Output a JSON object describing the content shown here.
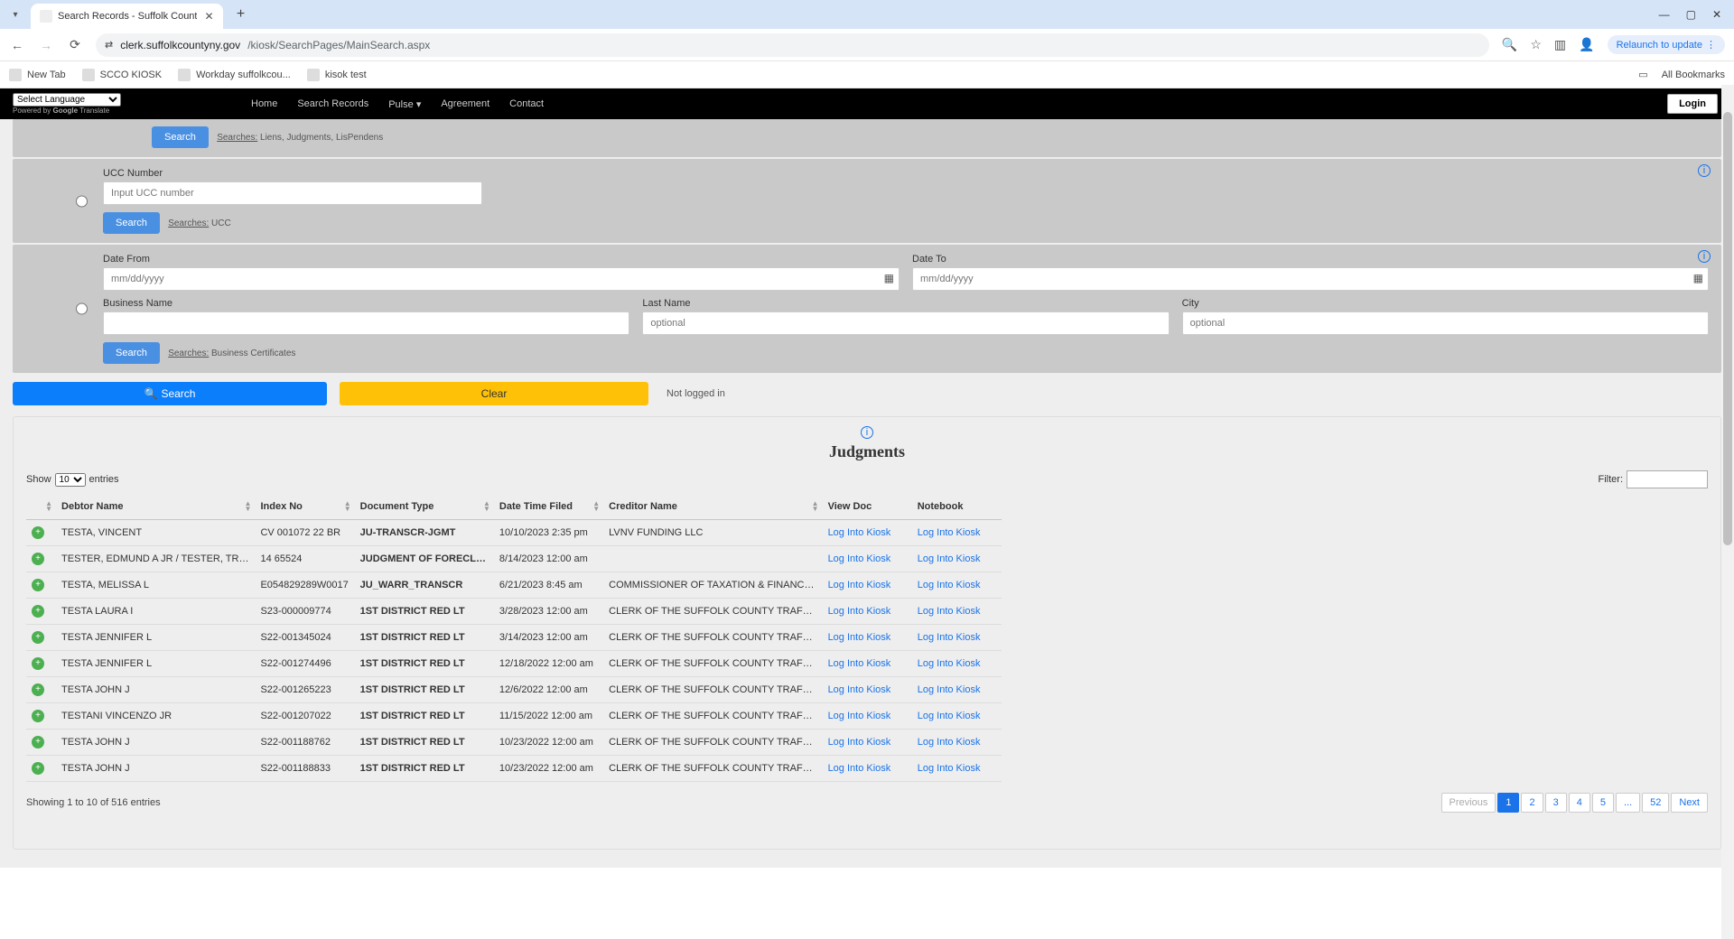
{
  "browser": {
    "tab_title": "Search Records - Suffolk Count",
    "url_host": "clerk.suffolkcountyny.gov",
    "url_path": "/kiosk/SearchPages/MainSearch.aspx",
    "relaunch": "Relaunch to update",
    "bookmarks": [
      "New Tab",
      "SCCO KIOSK",
      "Workday suffolkcou...",
      "kisok test"
    ],
    "all_bookmarks": "All Bookmarks"
  },
  "nav": {
    "lang": "Select Language",
    "powered": "Powered by ",
    "google": "Google",
    "translate": " Translate",
    "items": [
      "Home",
      "Search Records",
      "Pulse",
      "Agreement",
      "Contact"
    ],
    "login": "Login"
  },
  "panels": {
    "search_label": "Search",
    "searches_word": "Searches:",
    "liens_note": " Liens, Judgments, LisPendens",
    "ucc": {
      "label": "UCC Number",
      "placeholder": "Input UCC number",
      "note": " UCC"
    },
    "dates": {
      "from_label": "Date From",
      "to_label": "Date To",
      "date_ph": "mm/dd/yyyy",
      "business": "Business Name",
      "last": "Last Name",
      "city": "City",
      "optional": "optional",
      "note": " Business Certificates"
    },
    "big_search": "Search",
    "big_clear": "Clear",
    "not_logged": "Not logged in"
  },
  "results": {
    "title": "Judgments",
    "show_pre": "Show",
    "show_val": "10",
    "show_post": "entries",
    "filter_label": "Filter:",
    "columns": [
      "",
      "Debtor Name",
      "Index No",
      "Document Type",
      "Date Time Filed",
      "Creditor Name",
      "View Doc",
      "Notebook"
    ],
    "log_into": "Log Into Kiosk",
    "rows": [
      {
        "debtor": "TESTA, VINCENT",
        "index": "CV 001072 22 BR",
        "doctype": "JU-TRANSCR-JGMT",
        "dt": "10/10/2023 2:35 pm",
        "creditor": "LVNV FUNDING LLC"
      },
      {
        "debtor": "TESTER, EDMUND A JR / TESTER, TRAC...",
        "index": "14 65524",
        "doctype": "JUDGMENT OF FORECLOS",
        "dt": "8/14/2023 12:00 am",
        "creditor": ""
      },
      {
        "debtor": "TESTA, MELISSA L",
        "index": "E054829289W0017",
        "doctype": "JU_WARR_TRANSCR",
        "dt": "6/21/2023 8:45 am",
        "creditor": "COMMISSIONER OF TAXATION & FINANCE ..."
      },
      {
        "debtor": "TESTA LAURA I",
        "index": "S23-000009774",
        "doctype": "1ST DISTRICT RED LT",
        "dt": "3/28/2023 12:00 am",
        "creditor": "CLERK OF THE SUFFOLK COUNTY TRAFFIC & ..."
      },
      {
        "debtor": "TESTA JENNIFER L",
        "index": "S22-001345024",
        "doctype": "1ST DISTRICT RED LT",
        "dt": "3/14/2023 12:00 am",
        "creditor": "CLERK OF THE SUFFOLK COUNTY TRAFFIC & ..."
      },
      {
        "debtor": "TESTA JENNIFER L",
        "index": "S22-001274496",
        "doctype": "1ST DISTRICT RED LT",
        "dt": "12/18/2022 12:00 am",
        "creditor": "CLERK OF THE SUFFOLK COUNTY TRAFFIC & ..."
      },
      {
        "debtor": "TESTA JOHN J",
        "index": "S22-001265223",
        "doctype": "1ST DISTRICT RED LT",
        "dt": "12/6/2022 12:00 am",
        "creditor": "CLERK OF THE SUFFOLK COUNTY TRAFFIC & ..."
      },
      {
        "debtor": "TESTANI VINCENZO JR",
        "index": "S22-001207022",
        "doctype": "1ST DISTRICT RED LT",
        "dt": "11/15/2022 12:00 am",
        "creditor": "CLERK OF THE SUFFOLK COUNTY TRAFFIC & ..."
      },
      {
        "debtor": "TESTA JOHN J",
        "index": "S22-001188762",
        "doctype": "1ST DISTRICT RED LT",
        "dt": "10/23/2022 12:00 am",
        "creditor": "CLERK OF THE SUFFOLK COUNTY TRAFFIC & ..."
      },
      {
        "debtor": "TESTA JOHN J",
        "index": "S22-001188833",
        "doctype": "1ST DISTRICT RED LT",
        "dt": "10/23/2022 12:00 am",
        "creditor": "CLERK OF THE SUFFOLK COUNTY TRAFFIC & ..."
      }
    ],
    "showing": "Showing 1 to 10 of 516 entries",
    "pages": {
      "prev": "Previous",
      "next": "Next",
      "nums": [
        "1",
        "2",
        "3",
        "4",
        "5",
        "...",
        "52"
      ]
    }
  }
}
